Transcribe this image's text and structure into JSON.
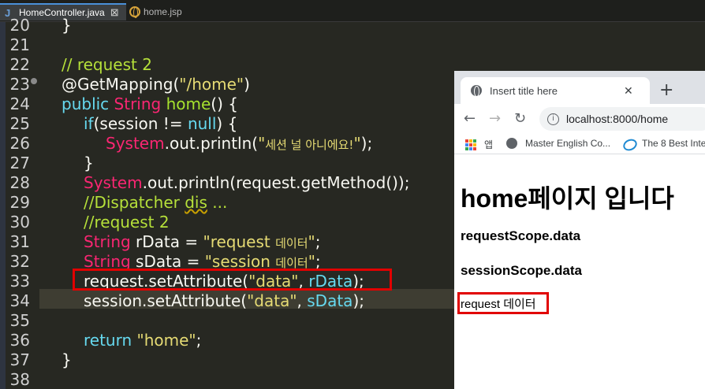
{
  "editor": {
    "tabs": [
      {
        "label": "HomeController.java",
        "close": "⊠",
        "active": true
      },
      {
        "label": "home.jsp",
        "active": false
      }
    ],
    "line_numbers": [
      "20",
      "21",
      "22",
      "23",
      "24",
      "25",
      "26",
      "27",
      "28",
      "29",
      "30",
      "31",
      "32",
      "33",
      "34",
      "35",
      "36",
      "37",
      "38"
    ],
    "code": {
      "l20": "}",
      "l22": "// request 2",
      "l23_anno": "@GetMapping(",
      "l23_str": "\"/home\"",
      "l23_end": ")",
      "l24_kw": "public ",
      "l24_type": "String ",
      "l24_name": "home",
      "l24_end": "() {",
      "l25_kw": "if",
      "l25_a": "(session != ",
      "l25_null": "null",
      "l25_end": ") {",
      "l26_sys": "System",
      "l26_mid": ".out.println(",
      "l26_q1": "\"",
      "l26_ko": "세션 널 아니에요!",
      "l26_q2": "\"",
      "l26_end": ");",
      "l27": "}",
      "l28_sys": "System",
      "l28_mid": ".out.println(request.getMethod());",
      "l29_a": "//Dispatcher ",
      "l29_b": "dis",
      "l29_c": " ...",
      "l30": "//request 2",
      "l31_type": "String ",
      "l31_var": "rData = ",
      "l31_s1": "\"request ",
      "l31_ko": "데이터",
      "l31_s2": "\"",
      "l31_end": ";",
      "l32_type": "String ",
      "l32_var": "sData = ",
      "l32_s1": "\"session ",
      "l32_ko": "데이터",
      "l32_s2": "\"",
      "l32_end": ";",
      "l33_a": "request.setAttribute(",
      "l33_str": "\"data\"",
      "l33_b": ", ",
      "l33_var": "rData",
      "l33_end": ");",
      "l34_a": "session.setAttribute(",
      "l34_str": "\"data\"",
      "l34_b": ", ",
      "l34_var": "sData",
      "l34_end": ");",
      "l36_kw": "return ",
      "l36_str": "\"home\"",
      "l36_end": ";",
      "l37": "}"
    }
  },
  "browser": {
    "tab_title": "Insert title here",
    "tab_close": "✕",
    "new_tab": "+",
    "url": "localhost:8000/home",
    "bookmarks": [
      {
        "label": "앱",
        "icon": "apps-icon"
      },
      {
        "label": "Master English Co...",
        "icon": "globe-icon"
      },
      {
        "label": "The 8 Best Inte",
        "icon": "hd-logo-icon"
      }
    ],
    "page": {
      "heading": "home페이지 입니다",
      "request_scope": "requestScope.data",
      "session_scope": "sessionScope.data",
      "result": "request 데이터"
    }
  },
  "colors": {
    "editor_bg": "#272822",
    "current_line": "#3e3d32",
    "highlight_box": "#e10000"
  }
}
